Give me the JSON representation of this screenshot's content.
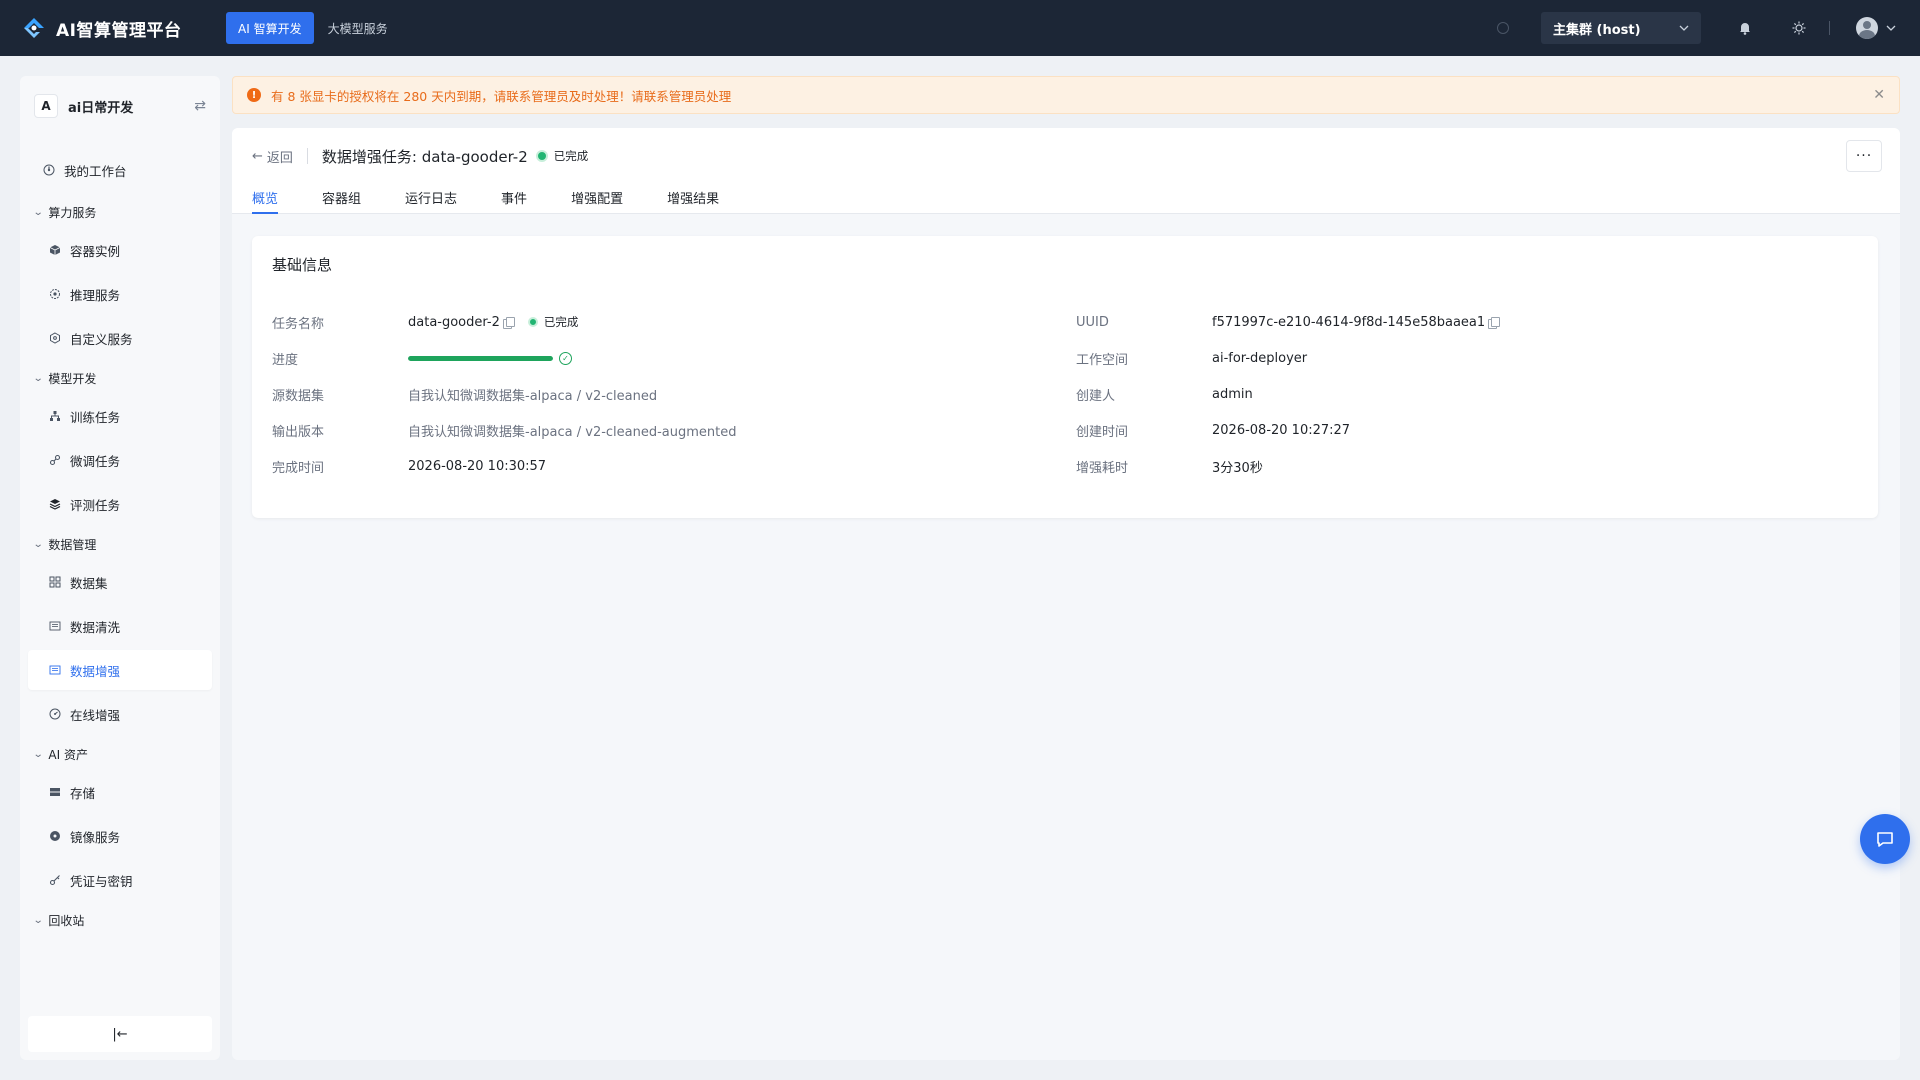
{
  "topbar": {
    "brand": "AI智算管理平台",
    "nav": [
      {
        "label": "AI 智算开发",
        "active": true
      },
      {
        "label": "大模型服务",
        "active": false
      }
    ],
    "cluster": "主集群 (host)"
  },
  "sidebar": {
    "workspace_initial": "A",
    "workspace_name": "ai日常开发",
    "switch_glyph": "⇄",
    "workbench": {
      "label": "我的工作台",
      "icon": "dashboard-icon"
    },
    "groups": [
      {
        "title": "算力服务",
        "items": [
          {
            "label": "容器实例",
            "icon": "cube-icon"
          },
          {
            "label": "推理服务",
            "icon": "gear-cube-icon"
          },
          {
            "label": "自定义服务",
            "icon": "hexagon-icon"
          }
        ]
      },
      {
        "title": "模型开发",
        "items": [
          {
            "label": "训练任务",
            "icon": "hierarchy-icon"
          },
          {
            "label": "微调任务",
            "icon": "link-icon"
          },
          {
            "label": "评测任务",
            "icon": "layers-icon"
          }
        ]
      },
      {
        "title": "数据管理",
        "items": [
          {
            "label": "数据集",
            "icon": "grid-icon"
          },
          {
            "label": "数据清洗",
            "icon": "table-icon"
          },
          {
            "label": "数据增强",
            "icon": "table-icon",
            "active": true
          },
          {
            "label": "在线增强",
            "icon": "gauge-icon"
          }
        ]
      },
      {
        "title": "AI 资产",
        "items": [
          {
            "label": "存储",
            "icon": "storage-icon"
          },
          {
            "label": "镜像服务",
            "icon": "disc-icon"
          },
          {
            "label": "凭证与密钥",
            "icon": "key-icon"
          }
        ]
      },
      {
        "title": "回收站",
        "items": []
      }
    ],
    "collapse_glyph": "|←"
  },
  "alert": {
    "text": "有 8 张显卡的授权将在 280 天内到期，请联系管理员及时处理！请联系管理员处理",
    "color": "#e86c1b"
  },
  "page": {
    "back_label": "返回",
    "title": "数据增强任务: data-gooder-2",
    "status": "已完成",
    "tabs": [
      "概览",
      "容器组",
      "运行日志",
      "事件",
      "增强配置",
      "增强结果"
    ],
    "active_tab": 0
  },
  "basic_info": {
    "title": "基础信息",
    "task_name_label": "任务名称",
    "task_name": "data-gooder-2",
    "task_status": "已完成",
    "progress_label": "进度",
    "progress_percent": 100,
    "source_label": "源数据集",
    "source_value": "自我认知微调数据集-alpaca / v2-cleaned",
    "output_label": "输出版本",
    "output_value": "自我认知微调数据集-alpaca / v2-cleaned-augmented",
    "finished_label": "完成时间",
    "finished_value": "2026-08-20 10:30:57",
    "uuid_label": "UUID",
    "uuid_value": "f571997c-e210-4614-9f8d-145e58baaea1",
    "workspace_label": "工作空间",
    "workspace_value": "ai-for-deployer",
    "creator_label": "创建人",
    "creator_value": "admin",
    "created_label": "创建时间",
    "created_value": "2026-08-20 10:27:27",
    "duration_label": "增强耗时",
    "duration_value": "3分30秒"
  },
  "colors": {
    "primary": "#2f6fed",
    "success": "#1ea45c",
    "topbar_bg": "#1c2636"
  }
}
